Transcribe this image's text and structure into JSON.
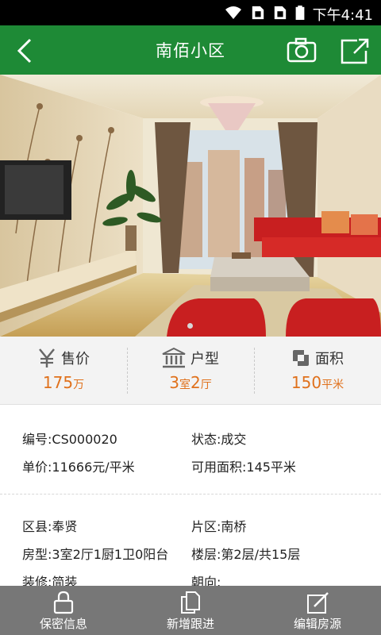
{
  "status_bar": {
    "time": "下午4:41"
  },
  "header": {
    "title": "南佰小区",
    "back_icon": "back-arrow-icon",
    "camera_icon": "camera-icon",
    "share_icon": "share-icon"
  },
  "summary": {
    "price": {
      "label": "售价",
      "value": "175",
      "unit": "万",
      "icon": "yen-icon"
    },
    "layout": {
      "label": "户型",
      "rooms": "3",
      "room_unit": "室",
      "halls": "2",
      "hall_unit": "厅",
      "icon": "building-icon"
    },
    "area": {
      "label": "面积",
      "value": "150",
      "unit": "平米",
      "icon": "area-icon"
    }
  },
  "details": {
    "code": "编号:CS000020",
    "status": "状态:成交",
    "unit_price": "单价:11666元/平米",
    "usable_area": "可用面积:145平米",
    "district": "区县:奉贤",
    "zone": "片区:南桥",
    "room_type": "房型:3室2厅1厨1卫0阳台",
    "floor": "楼层:第2层/共15层",
    "decoration": "装修:简装",
    "orientation": "朝向:"
  },
  "bottom_bar": {
    "privacy": "保密信息",
    "follow_up": "新增跟进",
    "edit": "编辑房源"
  },
  "colors": {
    "brand_green": "#1e8a36",
    "accent_orange": "#e0711c",
    "bottom_bar": "#777777"
  }
}
